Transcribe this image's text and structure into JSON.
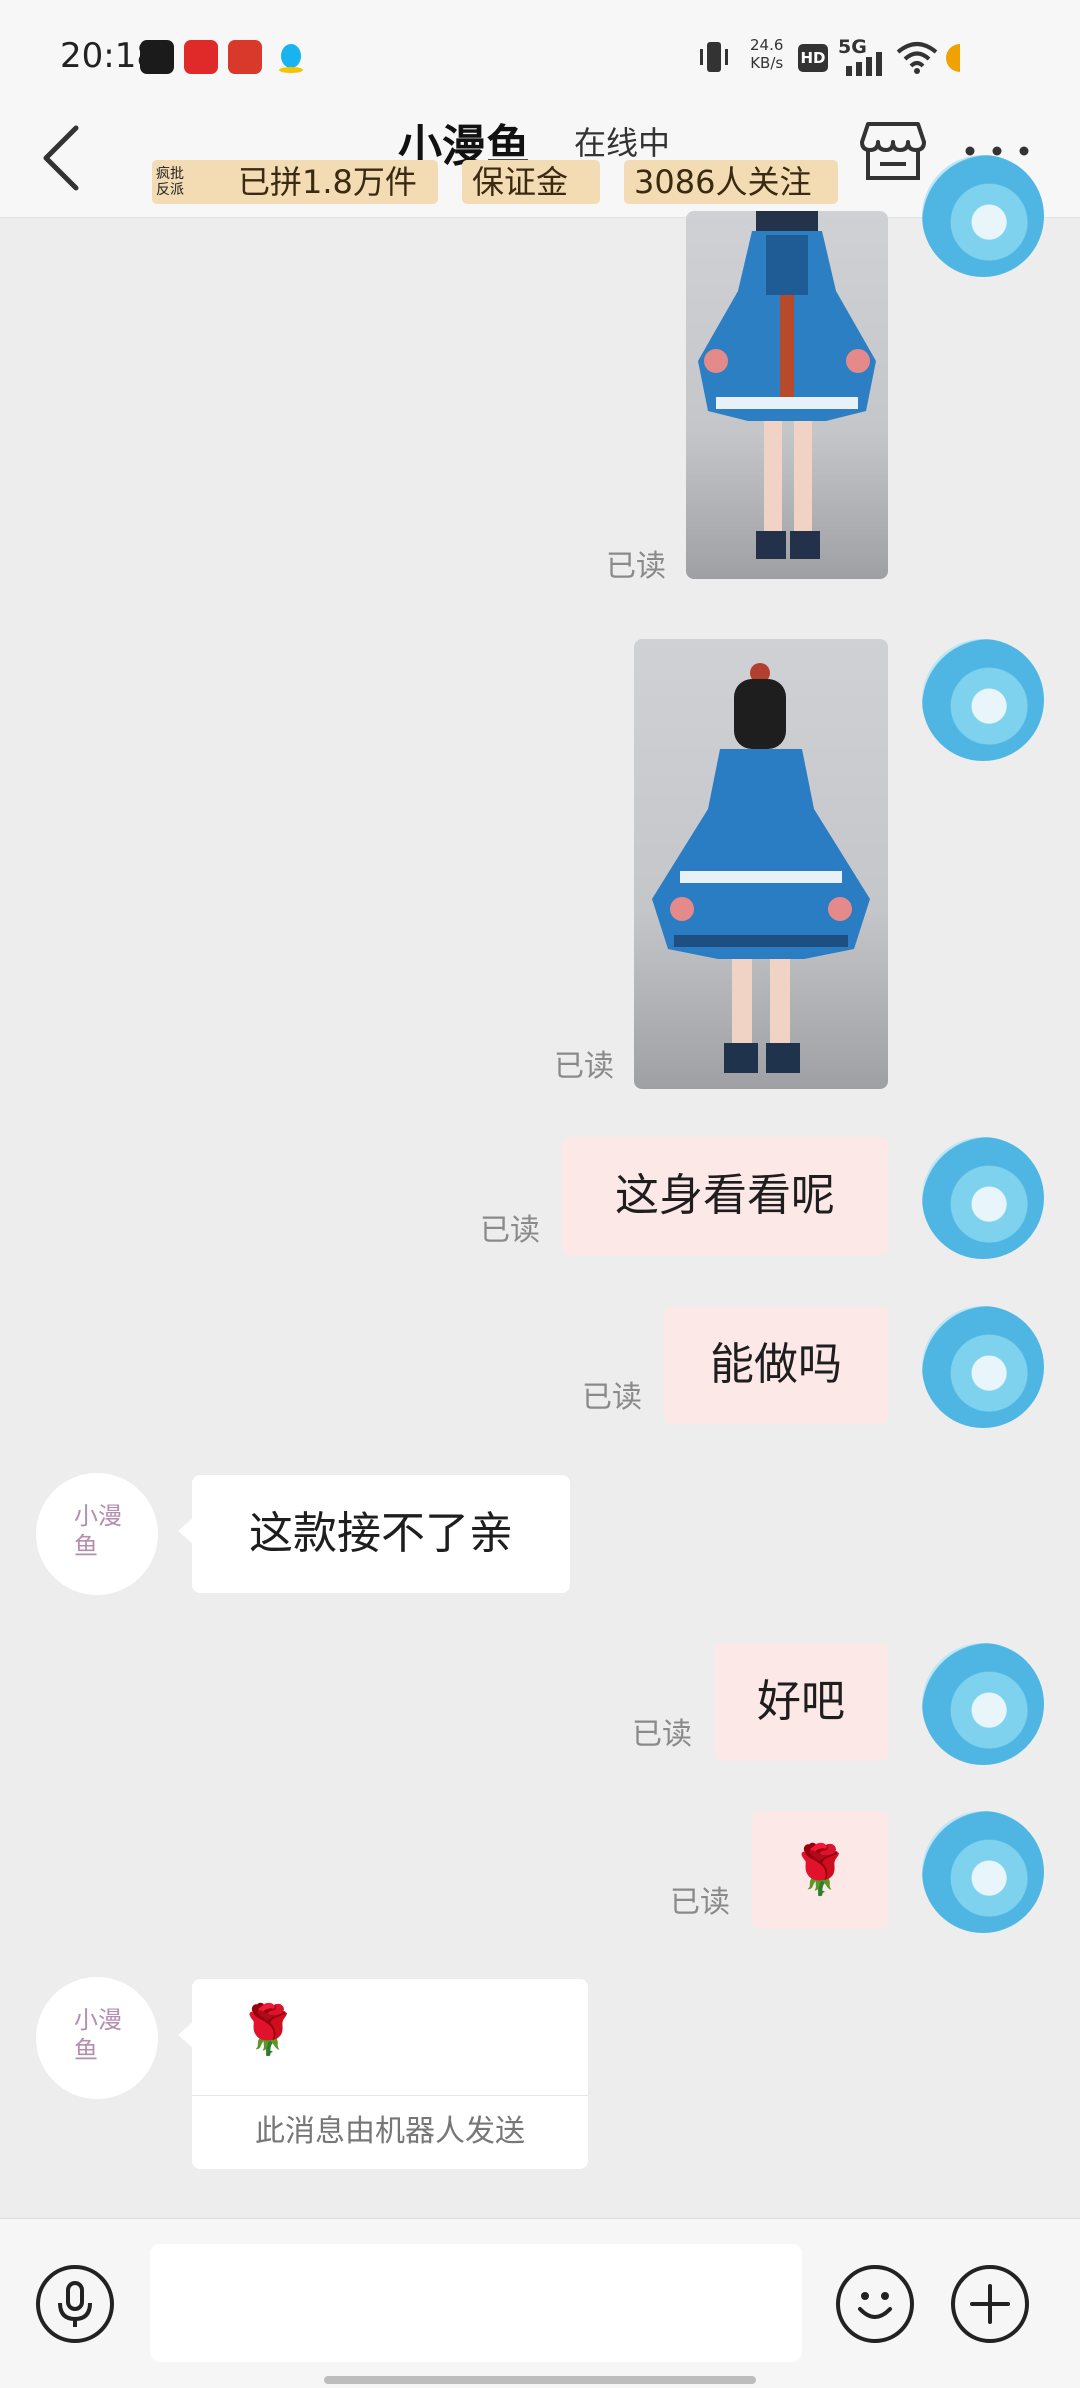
{
  "status_bar": {
    "time": "20:18",
    "net_speed_value": "24.6",
    "net_speed_unit": "KB/s",
    "hd_label": "HD",
    "network": "5G",
    "icons": [
      "vibrate-icon",
      "signal-icon",
      "wifi-icon",
      "battery-icon"
    ]
  },
  "header": {
    "title": "小漫鱼",
    "status": "在线中",
    "badge_tag": "疯批\n反派",
    "badges": [
      "已拼1.8万件",
      "保证金",
      "3086人关注"
    ],
    "back_icon": "chevron-left-icon",
    "shop_icon": "store-icon",
    "more_icon": "more-horizontal-icon"
  },
  "messages": [
    {
      "from": "me",
      "type": "image",
      "read": "已读"
    },
    {
      "from": "me",
      "type": "image",
      "read": "已读"
    },
    {
      "from": "me",
      "type": "text",
      "text": "这身看看呢",
      "read": "已读"
    },
    {
      "from": "me",
      "type": "text",
      "text": "能做吗",
      "read": "已读"
    },
    {
      "from": "shop",
      "type": "text",
      "text": "这款接不了亲"
    },
    {
      "from": "me",
      "type": "text",
      "text": "好吧",
      "read": "已读"
    },
    {
      "from": "me",
      "type": "text",
      "text": "🌹",
      "read": "已读"
    },
    {
      "from": "shop",
      "type": "text",
      "text": "🌹",
      "footnote": "此消息由机器人发送"
    }
  ],
  "shop_avatar_text": "小漫\n鱼",
  "input": {
    "placeholder": "",
    "voice_icon": "microphone-icon",
    "emoji_icon": "smiley-icon",
    "plus_icon": "plus-circle-icon"
  },
  "colors": {
    "background": "#ededed",
    "my_bubble": "#fde8e8",
    "shop_bubble": "#ffffff",
    "badge": "#f3dcb4"
  }
}
